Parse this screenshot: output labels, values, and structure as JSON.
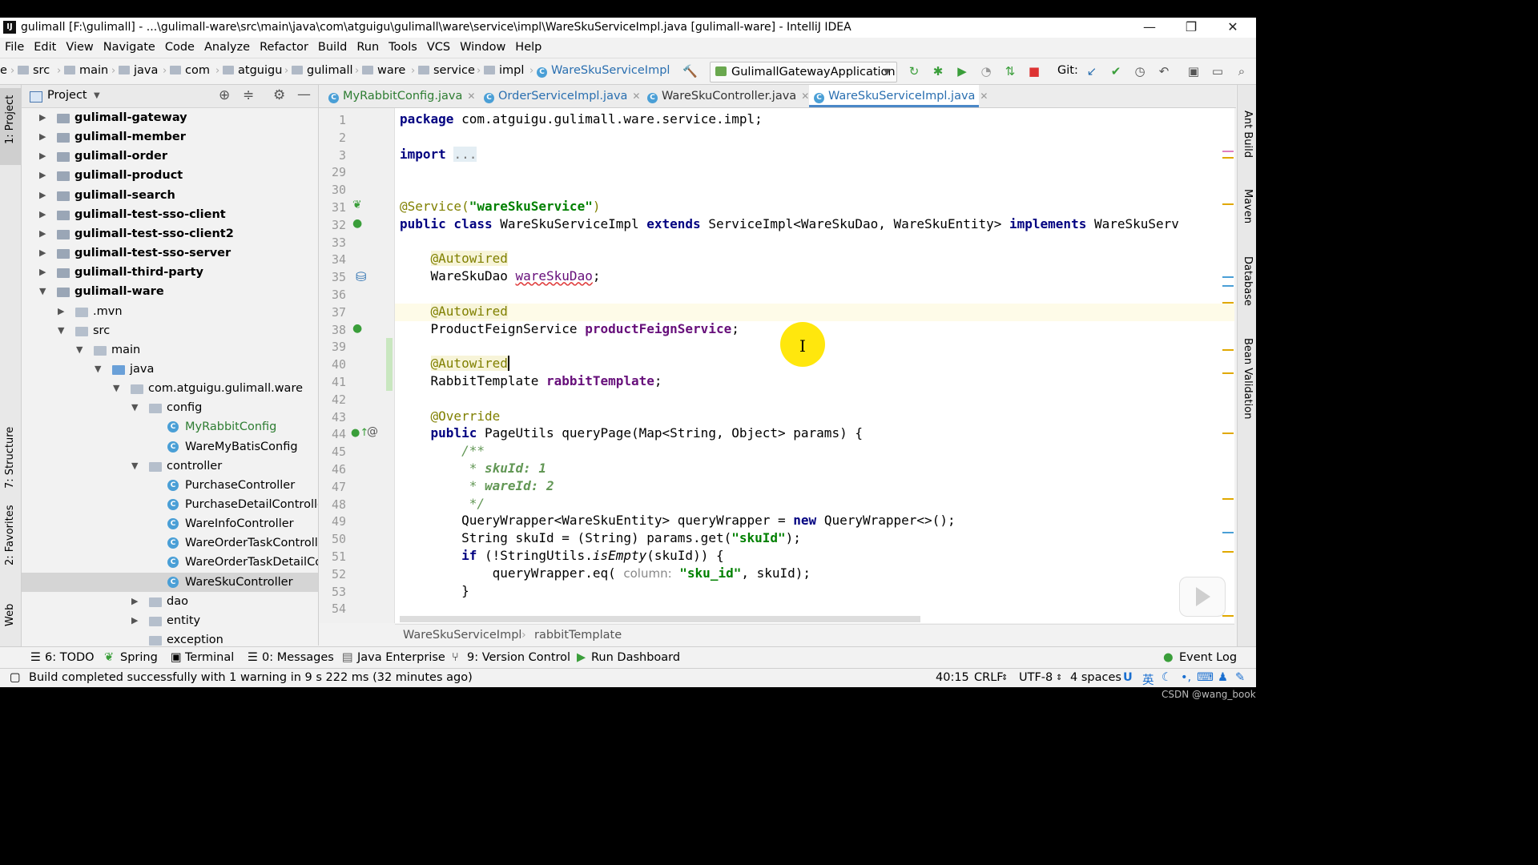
{
  "window": {
    "title": "gulimall [F:\\gulimall] - ...\\gulimall-ware\\src\\main\\java\\com\\atguigu\\gulimall\\ware\\service\\impl\\WareSkuServiceImpl.java [gulimall-ware] - IntelliJ IDEA",
    "minimize": "—",
    "restore": "❐",
    "close": "✕"
  },
  "menu": [
    "File",
    "Edit",
    "View",
    "Navigate",
    "Code",
    "Analyze",
    "Refactor",
    "Build",
    "Run",
    "Tools",
    "VCS",
    "Window",
    "Help"
  ],
  "nav": {
    "crumbs": [
      "e",
      "src",
      "main",
      "java",
      "com",
      "atguigu",
      "gulimall",
      "ware",
      "service",
      "impl",
      "WareSkuServiceImpl"
    ],
    "run_config": "GulimallGatewayApplication",
    "git_label": "Git:"
  },
  "left_stripe": {
    "project": "1: Project",
    "structure": "7: Structure",
    "favorites": "2: Favorites",
    "web": "Web"
  },
  "right_stripe": {
    "ant": "Ant Build",
    "maven": "Maven",
    "database": "Database",
    "bean": "Bean Validation"
  },
  "project": {
    "header": "Project",
    "tree": [
      {
        "label": "gulimall-gateway",
        "indent": 0,
        "expanded": false,
        "bold": true,
        "icon": "module"
      },
      {
        "label": "gulimall-member",
        "indent": 0,
        "expanded": false,
        "bold": true,
        "icon": "module"
      },
      {
        "label": "gulimall-order",
        "indent": 0,
        "expanded": false,
        "bold": true,
        "icon": "module"
      },
      {
        "label": "gulimall-product",
        "indent": 0,
        "expanded": false,
        "bold": true,
        "icon": "module"
      },
      {
        "label": "gulimall-search",
        "indent": 0,
        "expanded": false,
        "bold": true,
        "icon": "module"
      },
      {
        "label": "gulimall-test-sso-client",
        "indent": 0,
        "expanded": false,
        "bold": true,
        "icon": "module"
      },
      {
        "label": "gulimall-test-sso-client2",
        "indent": 0,
        "expanded": false,
        "bold": true,
        "icon": "module"
      },
      {
        "label": "gulimall-test-sso-server",
        "indent": 0,
        "expanded": false,
        "bold": true,
        "icon": "module"
      },
      {
        "label": "gulimall-third-party",
        "indent": 0,
        "expanded": false,
        "bold": true,
        "icon": "module"
      },
      {
        "label": "gulimall-ware",
        "indent": 0,
        "expanded": true,
        "bold": true,
        "icon": "module"
      },
      {
        "label": ".mvn",
        "indent": 1,
        "expanded": false,
        "bold": false,
        "icon": "folder"
      },
      {
        "label": "src",
        "indent": 1,
        "expanded": true,
        "bold": false,
        "icon": "folder"
      },
      {
        "label": "main",
        "indent": 2,
        "expanded": true,
        "bold": false,
        "icon": "folder"
      },
      {
        "label": "java",
        "indent": 3,
        "expanded": true,
        "bold": false,
        "icon": "folder-blue"
      },
      {
        "label": "com.atguigu.gulimall.ware",
        "indent": 4,
        "expanded": true,
        "bold": false,
        "icon": "package"
      },
      {
        "label": "config",
        "indent": 5,
        "expanded": true,
        "bold": false,
        "icon": "package"
      },
      {
        "label": "MyRabbitConfig",
        "indent": 6,
        "bold": false,
        "icon": "class",
        "color": "#2e7d32"
      },
      {
        "label": "WareMyBatisConfig",
        "indent": 6,
        "bold": false,
        "icon": "class"
      },
      {
        "label": "controller",
        "indent": 5,
        "expanded": true,
        "bold": false,
        "icon": "package"
      },
      {
        "label": "PurchaseController",
        "indent": 6,
        "bold": false,
        "icon": "class"
      },
      {
        "label": "PurchaseDetailController",
        "indent": 6,
        "bold": false,
        "icon": "class"
      },
      {
        "label": "WareInfoController",
        "indent": 6,
        "bold": false,
        "icon": "class"
      },
      {
        "label": "WareOrderTaskControlle",
        "indent": 6,
        "bold": false,
        "icon": "class"
      },
      {
        "label": "WareOrderTaskDetailCo",
        "indent": 6,
        "bold": false,
        "icon": "class"
      },
      {
        "label": "WareSkuController",
        "indent": 6,
        "bold": false,
        "icon": "class",
        "selected": true
      },
      {
        "label": "dao",
        "indent": 5,
        "expanded": false,
        "bold": false,
        "icon": "package"
      },
      {
        "label": "entity",
        "indent": 5,
        "expanded": false,
        "bold": false,
        "icon": "package"
      },
      {
        "label": "exception",
        "indent": 5,
        "bold": false,
        "icon": "package"
      }
    ]
  },
  "tabs": [
    {
      "label": "MyRabbitConfig.java",
      "color": "#2e7d32"
    },
    {
      "label": "OrderServiceImpl.java",
      "color": "#2a6fb0"
    },
    {
      "label": "WareSkuController.java",
      "color": "#333"
    },
    {
      "label": "WareSkuServiceImpl.java",
      "color": "#2a6fb0",
      "active": true
    }
  ],
  "code": {
    "current_line_index": 11,
    "lines": [
      {
        "n": "1",
        "html": "<span class='kw'>package</span> com.atguigu.gulimall.ware.service.impl;"
      },
      {
        "n": "2",
        "html": ""
      },
      {
        "n": "3",
        "html": "<span class='kw'>import</span> <span style='background:#e4eef4;color:#777'>...</span>"
      },
      {
        "n": "29",
        "html": ""
      },
      {
        "n": "30",
        "html": ""
      },
      {
        "n": "31",
        "html": "<span class='ann'>@Service(</span><span class='str'>\"wareSkuService\"</span><span class='ann'>)</span>"
      },
      {
        "n": "32",
        "html": "<span class='kw'>public class</span> WareSkuServiceImpl <span class='kw'>extends</span> ServiceImpl&lt;WareSkuDao, WareSkuEntity&gt; <span class='kw'>implements</span> WareSkuServ"
      },
      {
        "n": "33",
        "html": ""
      },
      {
        "n": "34",
        "html": "    <span class='ann' style='background:#f7f4d8'>@Autowired</span>"
      },
      {
        "n": "35",
        "html": "    WareSkuDao <span class='fld' style='font-weight:normal;text-decoration:underline wavy #e04040'>wareSkuDao</span>;"
      },
      {
        "n": "36",
        "html": ""
      },
      {
        "n": "37",
        "html": "    <span class='ann' style='background:#f7f4d8'>@Autowired</span>"
      },
      {
        "n": "38",
        "html": "    ProductFeignService <span class='fld'>productFeignService</span>;"
      },
      {
        "n": "39",
        "html": ""
      },
      {
        "n": "40",
        "html": "    <span class='ann' style='background:#f7f4d8'>@Autowired</span><span style='border-left:2px solid #000'></span>"
      },
      {
        "n": "41",
        "html": "    RabbitTemplate <span class='fld'>rabbitTemplate</span>;"
      },
      {
        "n": "42",
        "html": ""
      },
      {
        "n": "43",
        "html": "    <span class='ann'>@Override</span>"
      },
      {
        "n": "44",
        "html": "    <span class='kw'>public</span> PageUtils queryPage(Map&lt;String, Object&gt; params) {"
      },
      {
        "n": "45",
        "html": "        <span class='cmt'>/**</span>"
      },
      {
        "n": "46",
        "html": "<span class='cmt'>         * </span><span class='cmtb'>skuId: 1</span>"
      },
      {
        "n": "47",
        "html": "<span class='cmt'>         * </span><span class='cmtb'>wareId: 2</span>"
      },
      {
        "n": "48",
        "html": "<span class='cmt'>         */</span>"
      },
      {
        "n": "49",
        "html": "        QueryWrapper&lt;WareSkuEntity&gt; queryWrapper = <span class='kw'>new</span> QueryWrapper&lt;&gt;();"
      },
      {
        "n": "50",
        "html": "        String skuId = (String) params.get(<span class='str'>\"skuId\"</span>);"
      },
      {
        "n": "51",
        "html": "        <span class='kw'>if</span> (!StringUtils.<i>isEmpty</i>(skuId)) {"
      },
      {
        "n": "52",
        "html": "            queryWrapper.eq( <span class='hint'>column:</span> <span class='str'>\"sku_id\"</span>, skuId);"
      },
      {
        "n": "53",
        "html": "        }"
      },
      {
        "n": "54",
        "html": ""
      }
    ]
  },
  "editor_breadcrumb": [
    "WareSkuServiceImpl",
    "rabbitTemplate"
  ],
  "toolwindows": [
    "6: TODO",
    "Spring",
    "Terminal",
    "0: Messages",
    "Java Enterprise",
    "9: Version Control",
    "Run Dashboard"
  ],
  "event_log": "Event Log",
  "status": {
    "message": "Build completed successfully with 1 warning in 9 s 222 ms (32 minutes ago)",
    "position": "40:15",
    "line_sep": "CRLF",
    "encoding": "UTF-8",
    "indent": "4 spaces",
    "ime": "英"
  },
  "watermark": "CSDN @wang_book"
}
